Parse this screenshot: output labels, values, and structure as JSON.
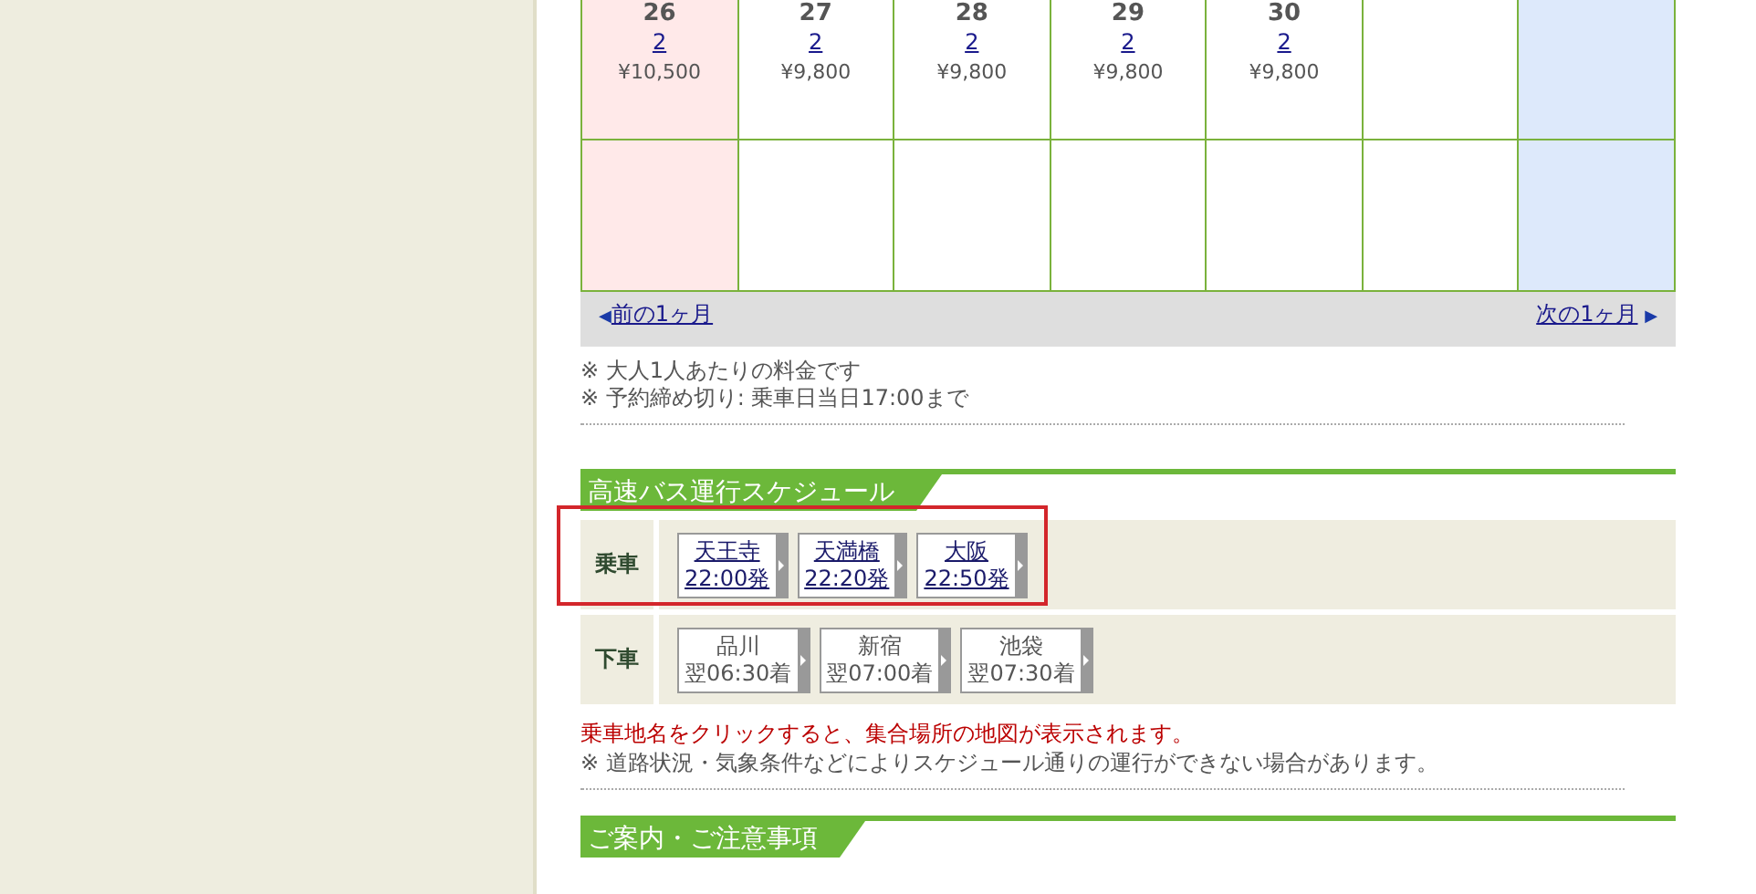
{
  "calendar": {
    "weeks": [
      {
        "cells": [
          {
            "kind": "sunday",
            "day": "26",
            "count": "2",
            "price": "¥10,500"
          },
          {
            "kind": "weekday",
            "day": "27",
            "count": "2",
            "price": "¥9,800"
          },
          {
            "kind": "weekday",
            "day": "28",
            "count": "2",
            "price": "¥9,800"
          },
          {
            "kind": "weekday",
            "day": "29",
            "count": "2",
            "price": "¥9,800"
          },
          {
            "kind": "weekday",
            "day": "30",
            "count": "2",
            "price": "¥9,800"
          },
          {
            "kind": "weekday"
          },
          {
            "kind": "saturday"
          }
        ]
      },
      {
        "cells": [
          {
            "kind": "sunday"
          },
          {
            "kind": "weekday"
          },
          {
            "kind": "weekday"
          },
          {
            "kind": "weekday"
          },
          {
            "kind": "weekday"
          },
          {
            "kind": "weekday"
          },
          {
            "kind": "saturday"
          }
        ]
      }
    ],
    "prev": {
      "arrow": "◀",
      "label": "前の1ヶ月"
    },
    "next": {
      "arrow": "▶",
      "label": "次の1ヶ月"
    },
    "notes": [
      "※ 大人1人あたりの料金です",
      "※ 予約締め切り: 乗車日当日17:00まで"
    ]
  },
  "schedule": {
    "title": "高速バス運行スケジュール",
    "rows": [
      {
        "label": "乗車",
        "highlighted": true,
        "stops": [
          {
            "name": "天王寺",
            "time": "22:00発",
            "link": true
          },
          {
            "name": "天満橋",
            "time": "22:20発",
            "link": true
          },
          {
            "name": "大阪",
            "time": "22:50発",
            "link": true
          }
        ]
      },
      {
        "label": "下車",
        "highlighted": false,
        "stops": [
          {
            "name": "品川",
            "time": "翌06:30着",
            "link": false
          },
          {
            "name": "新宿",
            "time": "翌07:00着",
            "link": false
          },
          {
            "name": "池袋",
            "time": "翌07:30着",
            "link": false
          }
        ]
      }
    ],
    "alert": "乗車地名をクリックすると、集合場所の地図が表示されます。",
    "note": "※ 道路状況・気象条件などによりスケジュール通りの運行ができない場合があります。"
  },
  "next_section": {
    "title": "ご案内・ご注意事項"
  }
}
